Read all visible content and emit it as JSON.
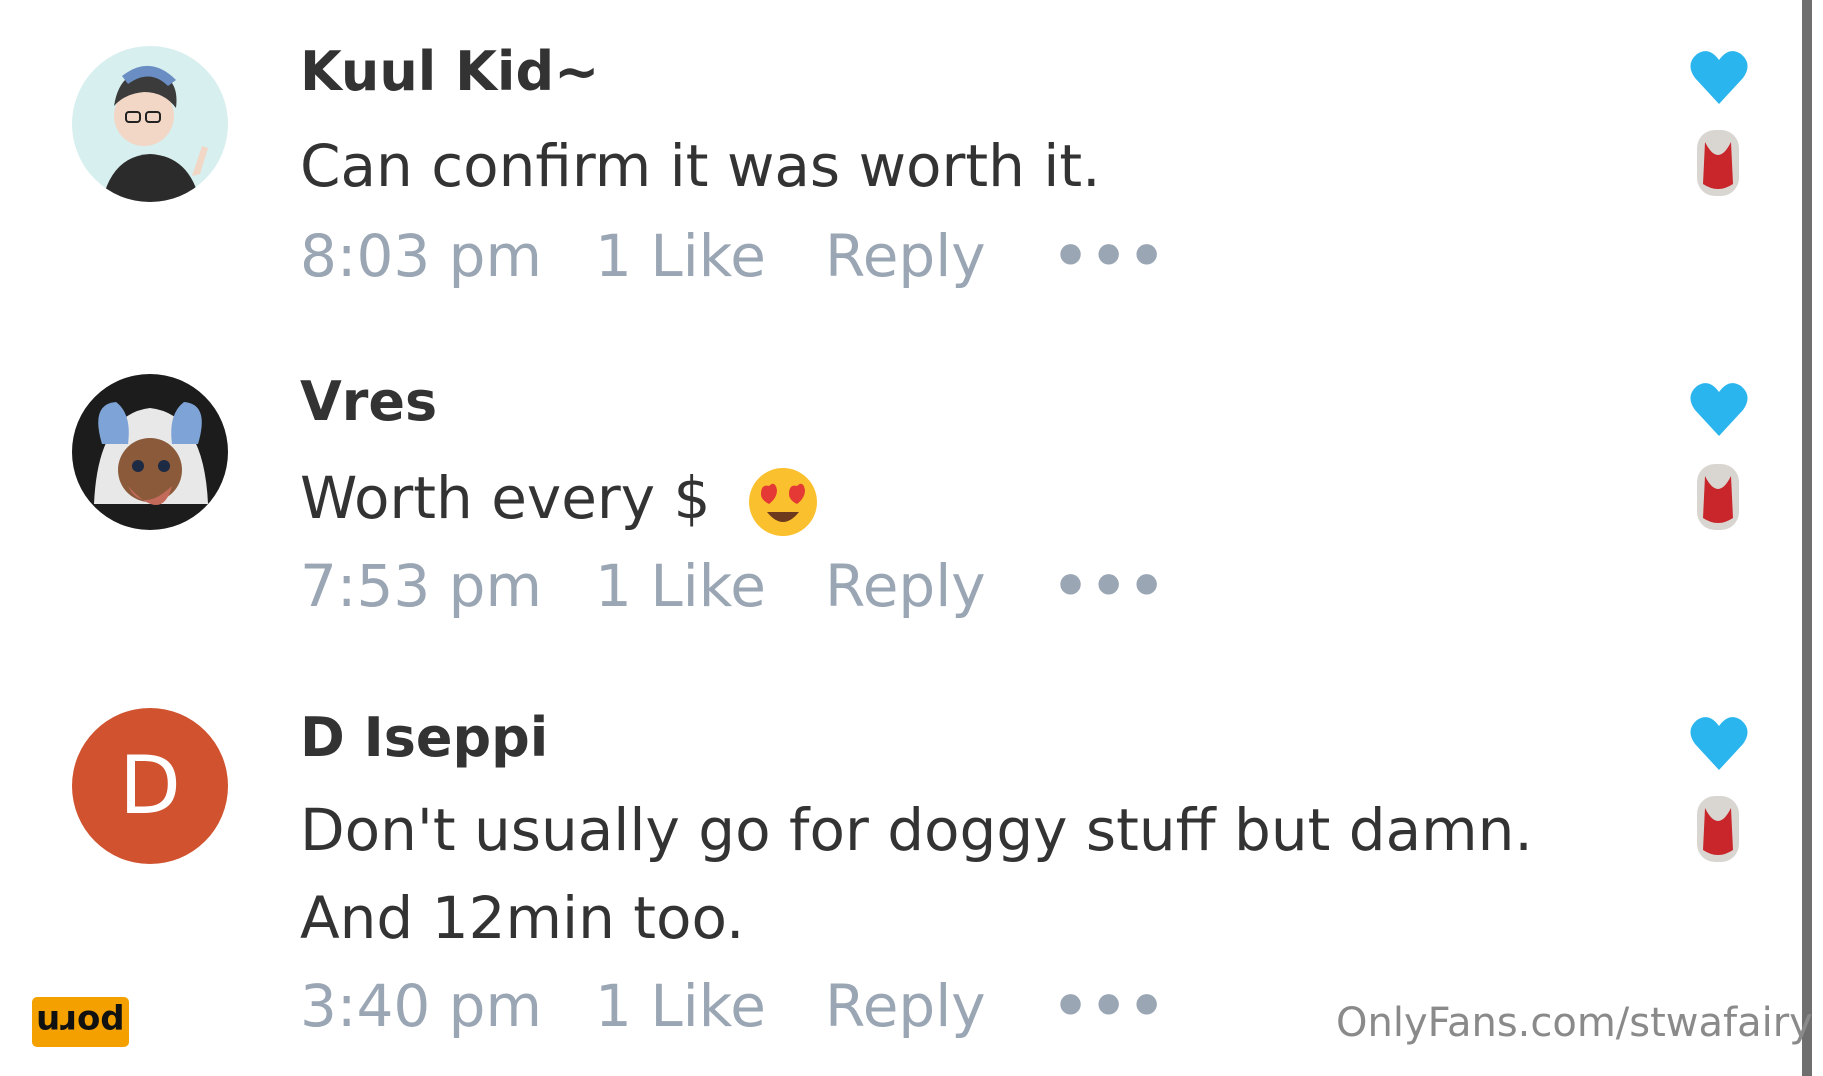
{
  "comments": [
    {
      "username": "Kuul Kid~",
      "text": "Can confirm it was worth it.",
      "time": "8:03 pm",
      "likes": "1 Like",
      "reply": "Reply",
      "more": "•••",
      "avatar": "avatar-illustration-glasses"
    },
    {
      "username": "Vres",
      "text": "Worth every $",
      "emoji": "heart-eyes-emoji",
      "time": "7:53 pm",
      "likes": "1 Like",
      "reply": "Reply",
      "more": "•••",
      "avatar": "avatar-illustration-hood"
    },
    {
      "username": "D Iseppi",
      "text": "Don't usually go for doggy stuff but damn. And 12min too.",
      "time": "3:40 pm",
      "likes": "1 Like",
      "reply": "Reply",
      "more": "•••",
      "avatar_letter": "D",
      "avatar_color": "#d0522f"
    }
  ],
  "colors": {
    "text": "#333333",
    "meta": "#9aa6b4",
    "heart": "#2bb5ee",
    "badge": "#f4a100"
  },
  "watermark": "OnlyFans.com/stwafairy",
  "badge": "porn"
}
